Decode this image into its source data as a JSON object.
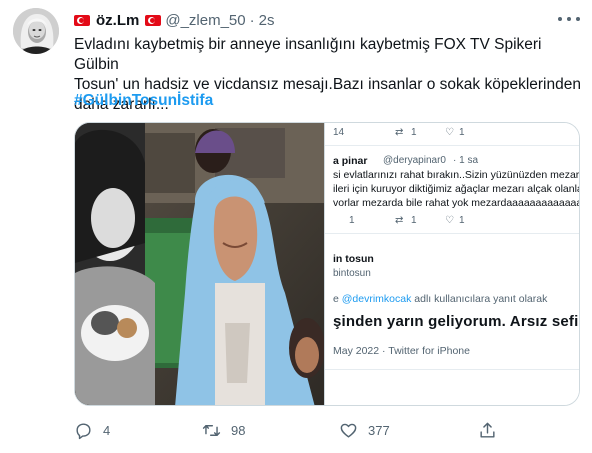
{
  "author": {
    "display_name": "öz.Lm",
    "handle": "@_zlem_50",
    "separator": "·",
    "time": "2s"
  },
  "tweet": {
    "text": "Evladını kaybetmiş bir anneye insanlığını kaybetmiş FOX TV Spikeri Gülbin\nTosun' un hadsiz ve vicdansız mesajı.Bazı insanlar o sokak köpeklerinden\ndaha zararlı...",
    "hashtag": "#GülbinTosunİstifa"
  },
  "embedded_screenshot": {
    "top_reply_count": "14",
    "top_retweet_count": "1",
    "top_like_count": "1",
    "reply_author": "a pinar",
    "reply_handle": "@deryapinar0",
    "reply_time": "· 1 sa",
    "reply_line_1": "si evlatlarınızı rahat bırakın..Sizin yüzünüzden mezarda b",
    "reply_line_2": "ileri için kuruyor diktiğimiz ağaçlar mezarı alçak olanların",
    "reply_line_3": "vorlar mezarda bile rahat yok mezardaaaaaaaaaaaaaaa",
    "reply_reply_count": "1",
    "reply_retweet_count": "1",
    "reply_like_count": "1",
    "quoted_author": "in tosun",
    "quoted_handle": "bintosun",
    "replying_to_prefix": "e",
    "replying_to_mention": "@devrimkocak",
    "replying_to_suffix": "adlı kullanıcılara yanıt olarak",
    "main_text": "şinden yarın geliyorum. Arsız sefil!",
    "date_source": "May 2022 · Twitter for iPhone"
  },
  "actions": {
    "reply_count": "4",
    "retweet_count": "98",
    "like_count": "377"
  },
  "colors": {
    "text_primary": "#0f1419",
    "text_secondary": "#536471",
    "link_blue": "#1d9bf0",
    "flag_red": "#e30a17"
  }
}
